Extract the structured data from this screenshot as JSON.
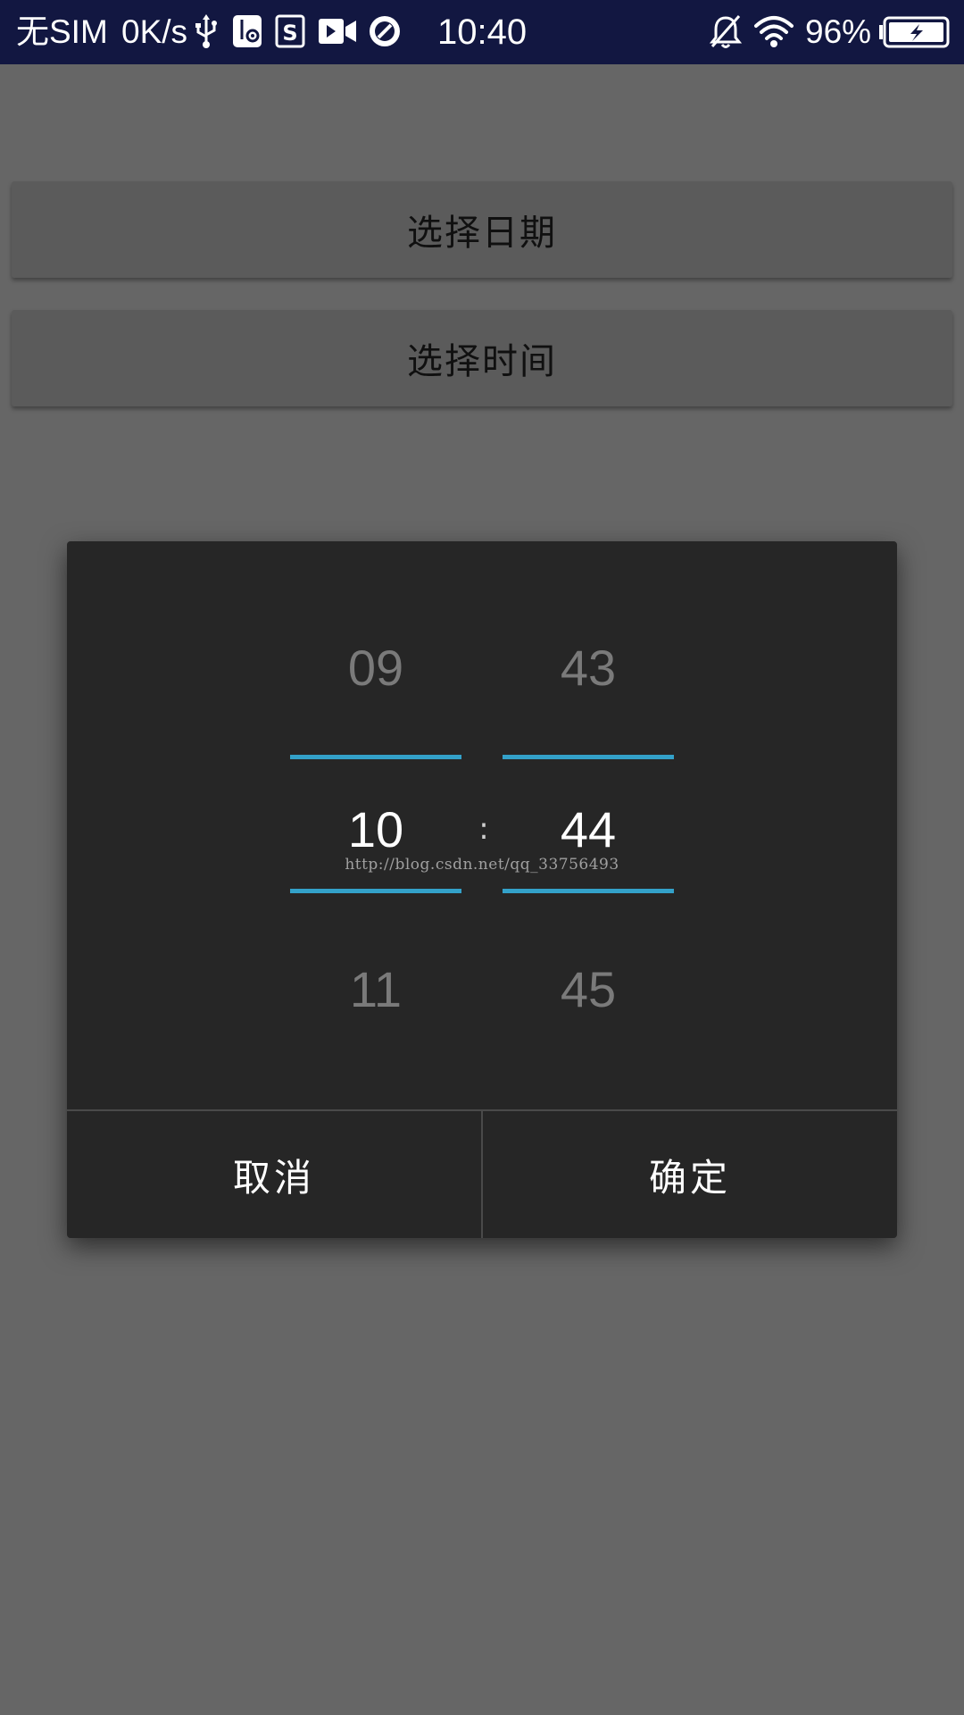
{
  "status_bar": {
    "carrier": "无SIM",
    "speed": "0K/s",
    "clock": "10:40",
    "battery_percent": "96%",
    "icons": [
      "usb-icon",
      "usb-debug-icon",
      "s-app-icon",
      "video-icon",
      "gauge-icon",
      "bell-off-icon",
      "wifi-icon",
      "battery-charging-icon"
    ]
  },
  "buttons": {
    "select_date": "选择日期",
    "select_time": "选择时间"
  },
  "time_picker": {
    "hour": {
      "prev": "09",
      "current": "10",
      "next": "11"
    },
    "minute": {
      "prev": "43",
      "current": "44",
      "next": "45"
    },
    "separator": ":",
    "watermark": "http://blog.csdn.net/qq_33756493",
    "accent_color": "#33a1c9"
  },
  "dialog_actions": {
    "cancel": "取消",
    "confirm": "确定"
  }
}
